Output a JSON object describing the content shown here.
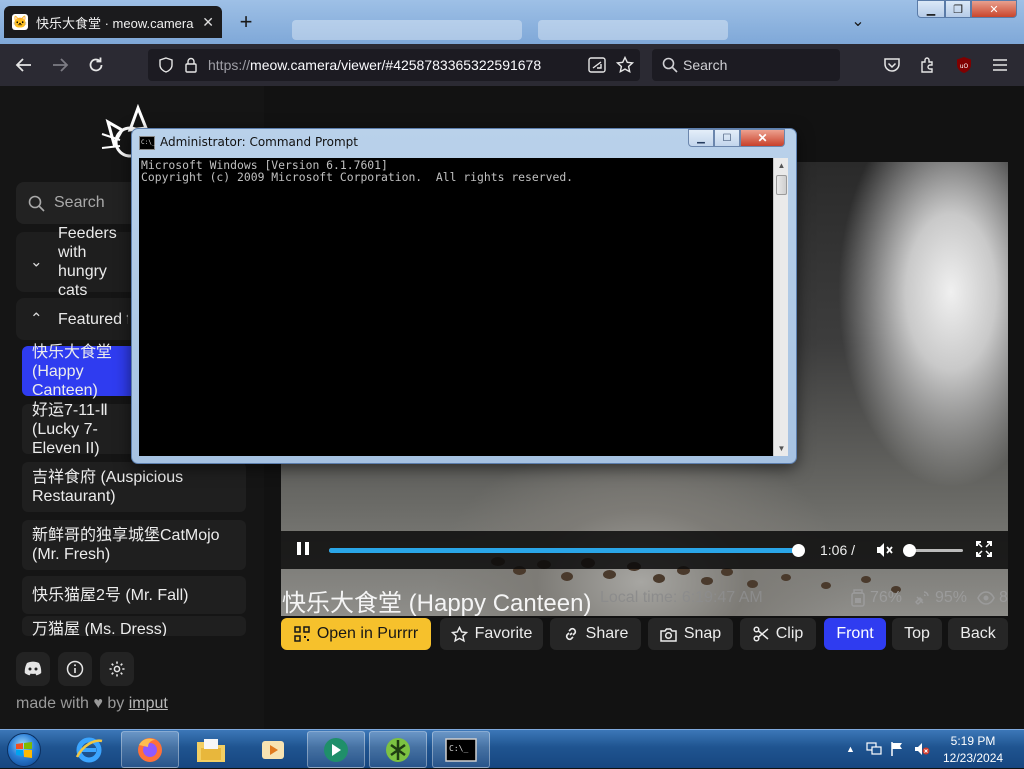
{
  "browser": {
    "tab": {
      "title": "快乐大食堂 · meow.camera",
      "favicon": "cat-icon"
    },
    "url": {
      "scheme": "https://",
      "rest": "meow.camera/viewer/#4258783365322591678"
    },
    "search_placeholder": "Search"
  },
  "sidebar": {
    "search_placeholder": "Search",
    "section_feeders": "Feeders with hungry cats",
    "section_featured": "Featured feeders",
    "items": [
      {
        "label": "快乐大食堂 (Happy Canteen)",
        "active": true
      },
      {
        "label": "好运7-11-Ⅱ (Lucky 7-Eleven II)",
        "active": false
      },
      {
        "label": "吉祥食府 (Auspicious Restaurant)",
        "active": false
      },
      {
        "label": "新鲜哥的独享城堡CatMojo (Mr. Fresh)",
        "active": false
      },
      {
        "label": "快乐猫屋2号 (Mr. Fall)",
        "active": false
      },
      {
        "label": "万猫屋 (Ms. Dress)",
        "active": false
      }
    ],
    "footer_made_with": "made with",
    "footer_by": "by",
    "footer_author": "imput"
  },
  "player": {
    "time": "1:06 /",
    "progress": 0.99,
    "volume": 0.0,
    "muted": true
  },
  "camera": {
    "title": "快乐大食堂 (Happy Canteen)",
    "local_time": "Local time: 6:19:47 AM",
    "food_level": "76%",
    "signal": "95%",
    "viewers": "8"
  },
  "actions": {
    "open": "Open in Purrrr",
    "favorite": "Favorite",
    "share": "Share",
    "snap": "Snap",
    "clip": "Clip",
    "front": "Front",
    "top": "Top",
    "back": "Back"
  },
  "cmd": {
    "title": "Administrator: Command Prompt",
    "lines": "Microsoft Windows [Version 6.1.7601]\nCopyright (c) 2009 Microsoft Corporation.  All rights reserved."
  },
  "taskbar": {
    "time": "5:19 PM",
    "date": "12/23/2024"
  },
  "colors": {
    "accent_blue": "#2f3cf0",
    "button_yellow": "#f6c12c",
    "progress_blue": "#2aa6e8"
  }
}
